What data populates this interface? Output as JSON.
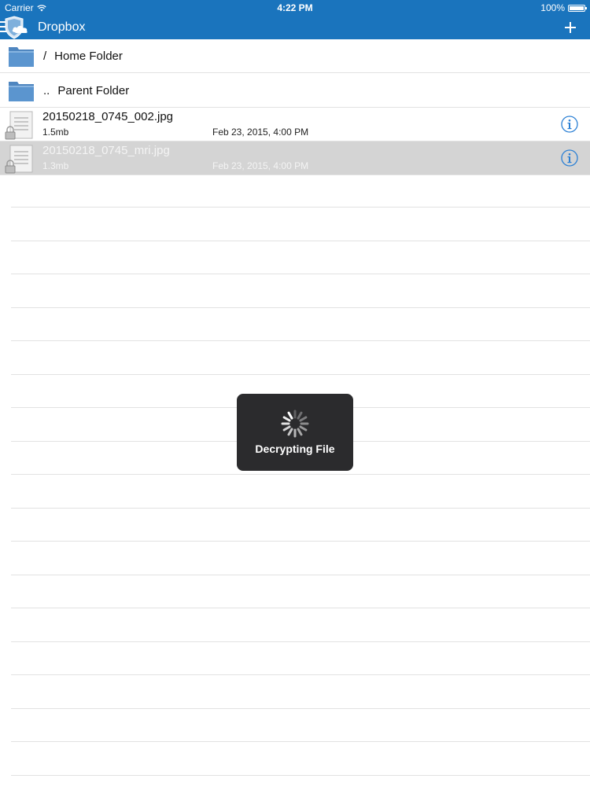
{
  "status_bar": {
    "carrier": "Carrier",
    "time": "4:22 PM",
    "battery": "100%"
  },
  "nav": {
    "title": "Dropbox",
    "add_label": "+"
  },
  "folders": [
    {
      "prefix": "/",
      "label": "Home Folder"
    },
    {
      "prefix": "..",
      "label": "Parent Folder"
    }
  ],
  "files": [
    {
      "name": "20150218_0745_002.jpg",
      "size": "1.5mb",
      "date": "Feb 23, 2015, 4:00 PM",
      "selected": false
    },
    {
      "name": "20150218_0745_mri.jpg",
      "size": "1.3mb",
      "date": "Feb 23, 2015, 4:00 PM",
      "selected": true
    }
  ],
  "hud": {
    "message": "Decrypting File"
  },
  "colors": {
    "nav_blue": "#1a74bd",
    "info_blue": "#2a7fd4",
    "selected_row": "#d4d4d4",
    "hud_bg": "#2b2b2d"
  },
  "icons": {
    "menu": "menu-icon",
    "logo": "shield-cloud-icon",
    "add": "plus-icon",
    "folder": "folder-icon",
    "file": "locked-document-icon",
    "info": "info-icon",
    "spinner": "spinner-icon",
    "wifi": "wifi-icon",
    "battery": "battery-icon"
  }
}
